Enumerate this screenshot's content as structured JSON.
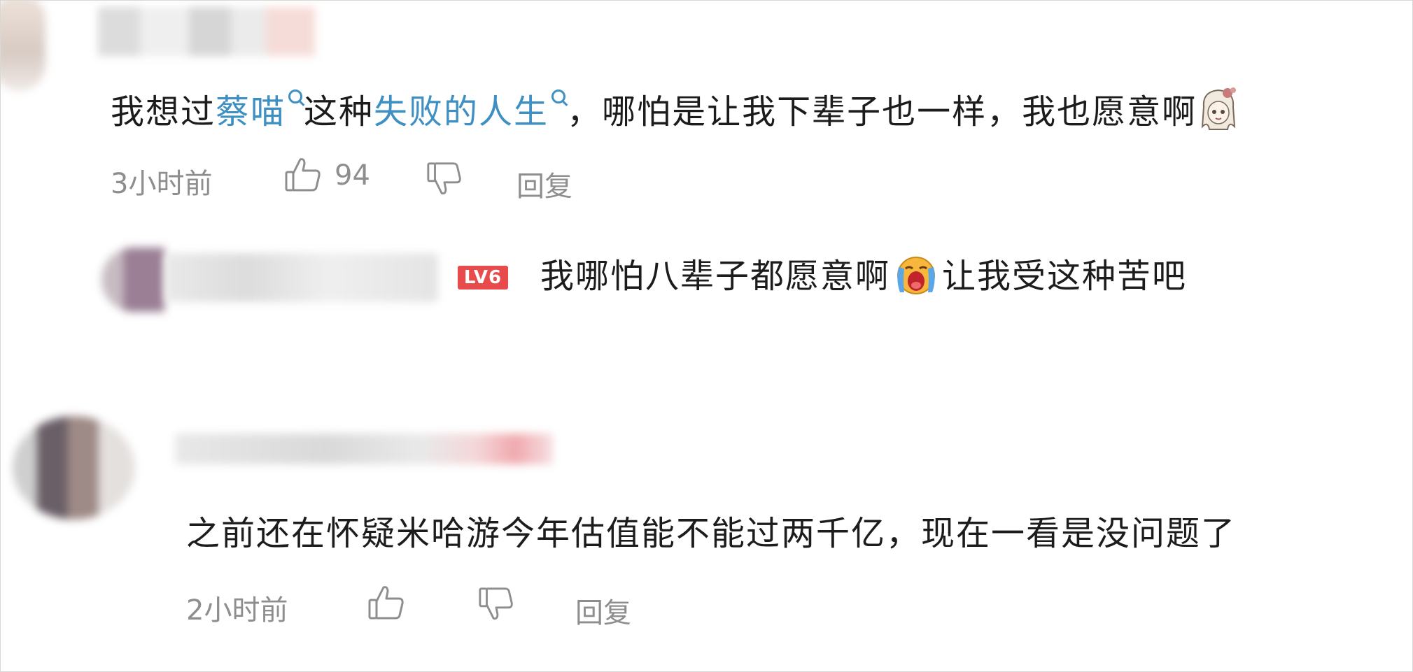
{
  "comments": [
    {
      "text_before_link1": "我想过",
      "link1": "蔡喵",
      "text_between": "这种",
      "link2": "失败的人生",
      "text_after": "，哪怕是让我下辈子也一样，我也愿意啊",
      "emoji": "girl-face-emoji",
      "time": "3小时前",
      "like_count": "94",
      "reply_label": "回复"
    },
    {
      "text": "之前还在怀疑米哈游今年估值能不能过两千亿，现在一看是没问题了",
      "time": "2小时前",
      "reply_label": "回复"
    }
  ],
  "reply": {
    "level_badge": "LV6",
    "text_before_emoji": "我哪怕八辈子都愿意啊",
    "emoji": "crying-face-emoji",
    "text_after_emoji": "让我受这种苦吧"
  },
  "colors": {
    "link": "#3e8fc2",
    "meta_text": "#8e8e8e",
    "level_badge": "#e84b4b"
  }
}
